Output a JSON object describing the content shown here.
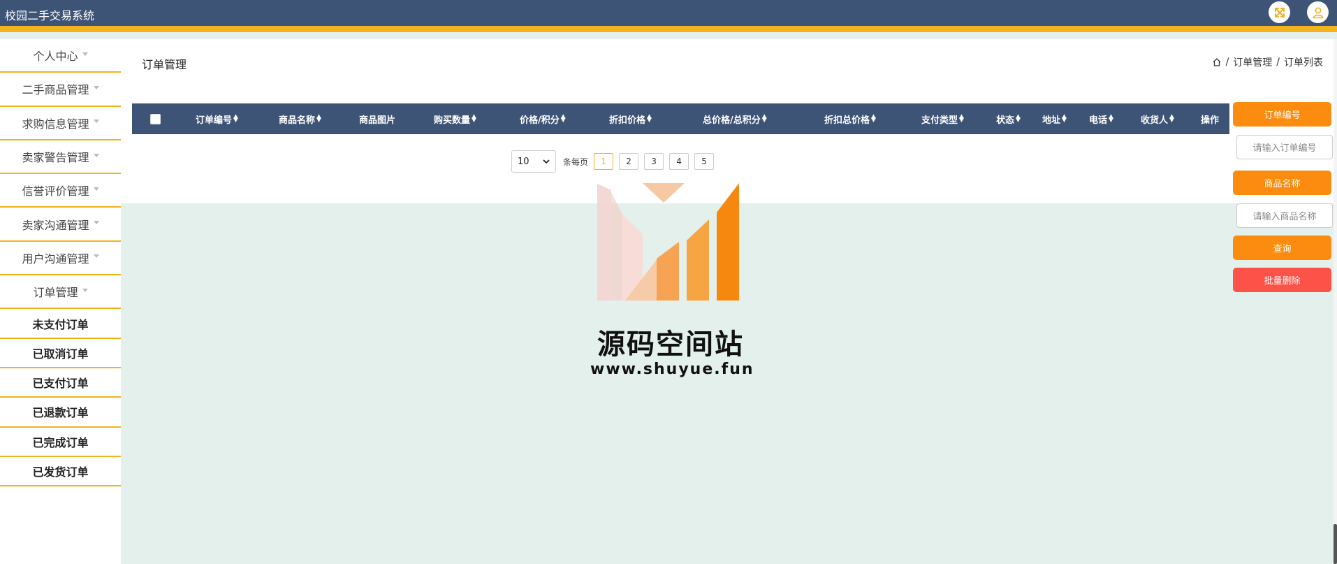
{
  "app": {
    "title": "校园二手交易系统"
  },
  "topbar": {
    "fullscreen_icon": "fullscreen-icon",
    "user_icon": "user-icon"
  },
  "sidebar": {
    "items": [
      {
        "label": "个人中心"
      },
      {
        "label": "二手商品管理"
      },
      {
        "label": "求购信息管理"
      },
      {
        "label": "卖家警告管理"
      },
      {
        "label": "信誉评价管理"
      },
      {
        "label": "卖家沟通管理"
      },
      {
        "label": "用户沟通管理"
      },
      {
        "label": "订单管理"
      }
    ],
    "subitems": [
      {
        "label": "未支付订单"
      },
      {
        "label": "已取消订单"
      },
      {
        "label": "已支付订单"
      },
      {
        "label": "已退款订单"
      },
      {
        "label": "已完成订单"
      },
      {
        "label": "已发货订单"
      }
    ]
  },
  "page": {
    "title": "订单管理",
    "breadcrumb": [
      "订单管理",
      "订单列表"
    ]
  },
  "table": {
    "columns": [
      {
        "label": "订单编号",
        "sortable": true
      },
      {
        "label": "商品名称",
        "sortable": true
      },
      {
        "label": "商品图片",
        "sortable": false
      },
      {
        "label": "购买数量",
        "sortable": true
      },
      {
        "label": "价格/积分",
        "sortable": true
      },
      {
        "label": "折扣价格",
        "sortable": true
      },
      {
        "label": "总价格/总积分",
        "sortable": true
      },
      {
        "label": "折扣总价格",
        "sortable": true
      },
      {
        "label": "支付类型",
        "sortable": true
      },
      {
        "label": "状态",
        "sortable": true
      },
      {
        "label": "地址",
        "sortable": true
      },
      {
        "label": "电话",
        "sortable": true
      },
      {
        "label": "收货人",
        "sortable": true
      },
      {
        "label": "操作",
        "sortable": false
      }
    ]
  },
  "pagination": {
    "page_size": "10",
    "per_page_label": "条每页",
    "pages": [
      "1",
      "2",
      "3",
      "4",
      "5"
    ],
    "current": "1"
  },
  "search": {
    "order_no_label": "订单编号",
    "order_no_placeholder": "请输入订单编号",
    "product_name_label": "商品名称",
    "product_name_placeholder": "请输入商品名称",
    "query_label": "查询",
    "batch_delete_label": "批量删除"
  },
  "watermark": {
    "title": "源码空间站",
    "url": "www.shuyue.fun"
  },
  "colors": {
    "header": "#3e5477",
    "accent": "#f4b21c",
    "button_orange": "#fb8c0f",
    "button_red": "#fc5248",
    "page_bg": "#e4f0ec"
  }
}
